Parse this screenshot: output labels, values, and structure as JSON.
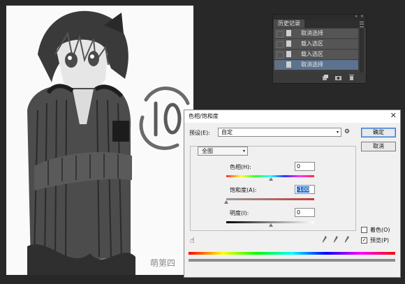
{
  "history_panel": {
    "collapse_glyph": "«",
    "close_glyph": "×",
    "tab_label": "历史记录",
    "items": [
      {
        "label": "取消选择",
        "selected": false
      },
      {
        "label": "载入选区",
        "selected": false
      },
      {
        "label": "载入选区",
        "selected": false
      },
      {
        "label": "取消选择",
        "selected": true
      }
    ],
    "footer_icons": [
      "new-document-from-state-icon",
      "camera-icon",
      "trash-icon"
    ]
  },
  "canvas": {
    "watermark": "萌第四"
  },
  "dialog": {
    "title": "色相/饱和度",
    "close_glyph": "✕",
    "preset_label": "预设(E):",
    "preset_value": "自定",
    "gear_glyph": "⚙",
    "channel_value": "全图",
    "hue_label": "色相(H):",
    "hue_value": "0",
    "saturation_label": "饱和度(A):",
    "saturation_value": "-100",
    "lightness_label": "明度(I):",
    "lightness_value": "0",
    "ok_label": "确定",
    "cancel_label": "取消",
    "colorize_label": "着色(O)",
    "colorize_checked": false,
    "preview_label": "预览(P)",
    "preview_checked": true,
    "preview_check_glyph": "✓",
    "hand_glyph": "☝",
    "dropdown_glyph": "▾",
    "colors": {
      "ok_border": "#3a76c9",
      "selected_field": "#3074c8"
    }
  }
}
